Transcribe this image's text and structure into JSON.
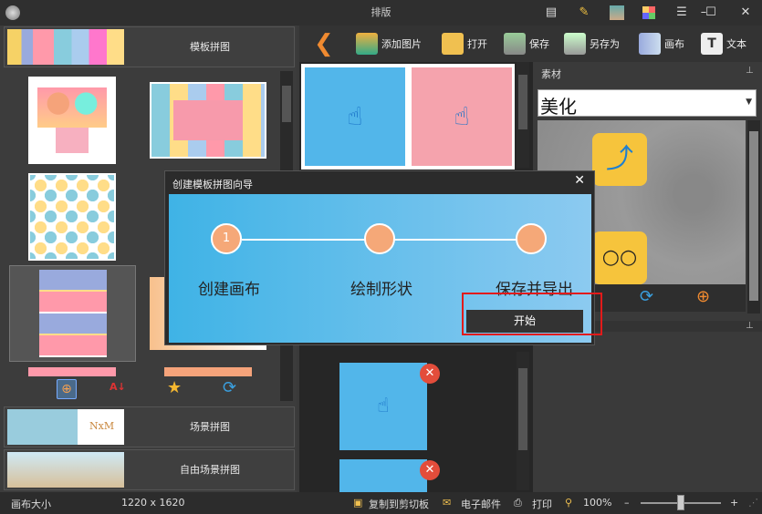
{
  "window": {
    "title": "排版"
  },
  "left": {
    "categories": [
      {
        "label": "模板拼图"
      },
      {
        "label": "场景拼图"
      },
      {
        "label": "自由场景拼图"
      }
    ],
    "thumb_text": "NxM"
  },
  "toolbar": {
    "add_image": "添加图片",
    "open": "打开",
    "save": "保存",
    "save_as": "另存为",
    "canvas": "画布",
    "text": "文本"
  },
  "material": {
    "panel_title": "素材",
    "dropdown_value": "美化"
  },
  "dialog": {
    "title": "创建模板拼图向导",
    "close": "✕",
    "steps": [
      {
        "num": "1",
        "label": "创建画布"
      },
      {
        "num": "",
        "label": "绘制形状"
      },
      {
        "num": "",
        "label": "保存并导出"
      }
    ],
    "start": "开始"
  },
  "status": {
    "canvas_size_label": "画布大小",
    "canvas_size_value": "1220 x 1620",
    "copy": "复制到剪切板",
    "email": "电子邮件",
    "print": "打印",
    "zoom": "100%",
    "zoom_level": 0.5
  },
  "colors": {
    "accent_blue": "#52b6ea",
    "accent_pink": "#f5a3ad",
    "step_orange": "#f5a878",
    "highlight_red": "#e21a1a"
  }
}
